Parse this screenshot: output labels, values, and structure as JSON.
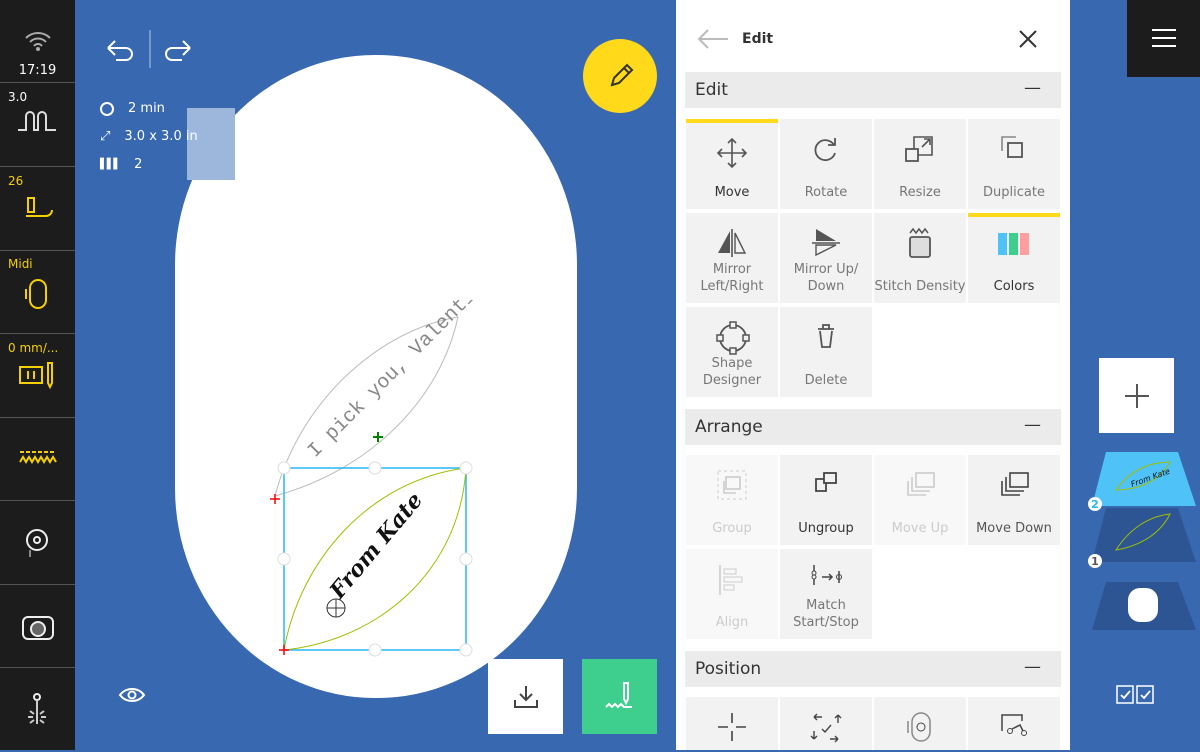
{
  "status": {
    "time": "17:19"
  },
  "sidebar": {
    "items": [
      {
        "label": "3.0",
        "icon": "stitch-width-icon"
      },
      {
        "label": "26",
        "icon": "presser-foot-icon"
      },
      {
        "label": "Midi",
        "icon": "hoop-icon"
      },
      {
        "label": "0 mm/...",
        "icon": "needle-position-icon"
      },
      {
        "label": "",
        "icon": "stitch-pattern-icon"
      },
      {
        "label": "",
        "icon": "pin-icon"
      },
      {
        "label": "",
        "icon": "camera-icon"
      },
      {
        "label": "",
        "icon": "needle-light-icon"
      }
    ]
  },
  "design_info": {
    "time": "2 min",
    "size": "3.0 x 3.0 in",
    "colors": "2"
  },
  "canvas": {
    "text1": "I pick you, Valentine!",
    "text2": "From Kate"
  },
  "panel": {
    "title": "Edit",
    "edit": {
      "header": "Edit",
      "tiles": [
        "Move",
        "Rotate",
        "Resize",
        "Duplicate",
        "Mirror Left/Right",
        "Mirror Up/ Down",
        "Stitch Density",
        "Colors",
        "Shape Designer",
        "Delete"
      ]
    },
    "arrange": {
      "header": "Arrange",
      "tiles": [
        "Group",
        "Ungroup",
        "Move Up",
        "Move Down",
        "Align",
        "Match Start/Stop"
      ]
    },
    "position": {
      "header": "Position"
    }
  },
  "layers": {
    "badges": [
      "2",
      "1"
    ]
  },
  "colors": {
    "accent": "#ffd91a",
    "canvas": "#3768b0",
    "selection": "#29b6f6",
    "stitch_green": "#3ecf8e"
  }
}
